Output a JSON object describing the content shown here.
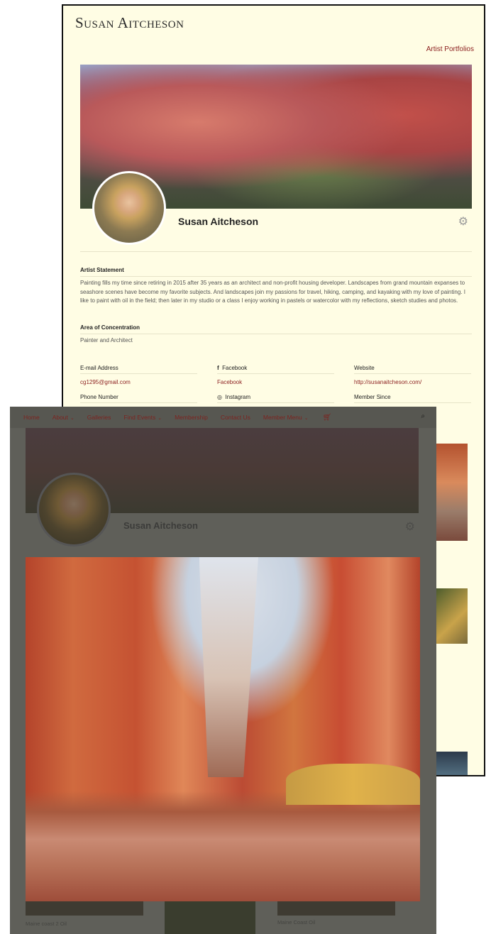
{
  "back_page": {
    "site_title": "Susan Aitcheson",
    "nav_link": "Artist Portfolios",
    "profile_name": "Susan Aitcheson",
    "artist_statement_label": "Artist Statement",
    "artist_statement": "Painting fills my time since retiring in 2015 after 35 years as an architect and non-profit housing developer. Landscapes from grand mountain expanses to seashore scenes have become my favorite subjects. And landscapes join my passions for travel, hiking, camping, and kayaking with my love of painting. I like to paint with oil in the field; then later in my studio or a class I enjoy working in pastels or watercolor with my reflections, sketch studies and photos.",
    "concentration_label": "Area of Concentration",
    "concentration_value": "Painter and Architect",
    "email_label": "E-mail Address",
    "email_value": "cg1295@gmail.com",
    "facebook_label": "Facebook",
    "facebook_value": "Facebook",
    "website_label": "Website",
    "website_value": "http://susanaitcheson.com/",
    "phone_label": "Phone Number",
    "instagram_label": "Instagram",
    "member_since_label": "Member Since"
  },
  "front_page": {
    "nav": [
      {
        "label": "Home",
        "caret": ""
      },
      {
        "label": "About",
        "caret": "⌄"
      },
      {
        "label": "Galleries",
        "caret": ""
      },
      {
        "label": "Find Events",
        "caret": "⌄"
      },
      {
        "label": "Membership",
        "caret": ""
      },
      {
        "label": "Contact Us",
        "caret": ""
      },
      {
        "label": "Member Menu",
        "caret": "⌄"
      }
    ],
    "cart_icon": "cart-icon",
    "search_icon": "search-icon",
    "profile_name": "Susan Aitcheson",
    "captions": [
      "Maine coast 2 Oil",
      "Maine Coast Oil"
    ]
  },
  "colors": {
    "page_bg": "#fffde4",
    "accent_red": "#8b1e1e",
    "overlay": "#5f5f59"
  }
}
